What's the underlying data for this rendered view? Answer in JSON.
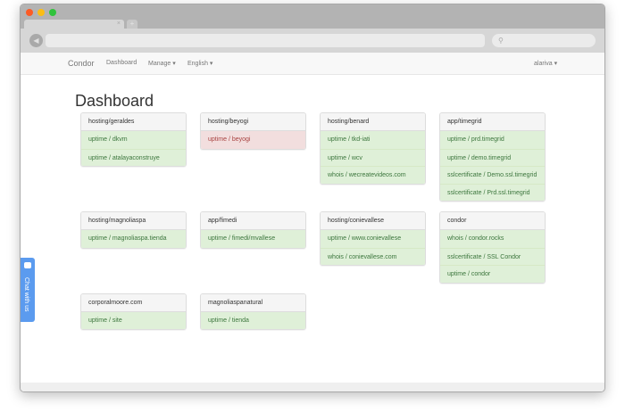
{
  "browser": {
    "tab_close": "×",
    "new_tab": "+",
    "back": "◀",
    "search_icon": "⚲"
  },
  "navbar": {
    "brand": "Condor",
    "links": [
      "Dashboard",
      "Manage ▾",
      "English ▾"
    ],
    "user": "alariva ▾"
  },
  "page_title": "Dashboard",
  "chat": {
    "label": "Chat with us"
  },
  "rows": [
    [
      {
        "title": "hosting/geraldes",
        "items": [
          {
            "text": "uptime / dkvm",
            "status": "ok"
          },
          {
            "text": "uptime / atalayaconstruye",
            "status": "ok"
          }
        ]
      },
      {
        "title": "hosting/beyogi",
        "items": [
          {
            "text": "uptime / beyogi",
            "status": "fail"
          }
        ]
      },
      {
        "title": "hosting/benard",
        "items": [
          {
            "text": "uptime / tkd-iati",
            "status": "ok"
          },
          {
            "text": "uptime / wcv",
            "status": "ok"
          },
          {
            "text": "whois / wecreatevideos.com",
            "status": "ok"
          }
        ]
      },
      {
        "title": "app/timegrid",
        "items": [
          {
            "text": "uptime / prd.timegrid",
            "status": "ok"
          },
          {
            "text": "uptime / demo.timegrid",
            "status": "ok"
          },
          {
            "text": "sslcertificate / Demo.ssl.timegrid",
            "status": "ok"
          },
          {
            "text": "sslcertificate / Prd.ssl.timegrid",
            "status": "ok"
          }
        ]
      }
    ],
    [
      {
        "title": "hosting/magnoliaspa",
        "items": [
          {
            "text": "uptime / magnoliaspa.tienda",
            "status": "ok"
          }
        ]
      },
      {
        "title": "app/fimedi",
        "items": [
          {
            "text": "uptime / fimedi/mvallese",
            "status": "ok"
          }
        ]
      },
      {
        "title": "hosting/conievallese",
        "items": [
          {
            "text": "uptime / www.conievallese",
            "status": "ok"
          },
          {
            "text": "whois / conievallese.com",
            "status": "ok"
          }
        ]
      },
      {
        "title": "condor",
        "items": [
          {
            "text": "whois / condor.rocks",
            "status": "ok"
          },
          {
            "text": "sslcertificate / SSL Condor",
            "status": "ok"
          },
          {
            "text": "uptime / condor",
            "status": "ok"
          }
        ]
      }
    ],
    [
      {
        "title": "corporalmoore.com",
        "items": [
          {
            "text": "uptime / site",
            "status": "ok"
          }
        ]
      },
      {
        "title": "magnoliaspanatural",
        "items": [
          {
            "text": "uptime / tienda",
            "status": "ok"
          }
        ]
      }
    ]
  ]
}
